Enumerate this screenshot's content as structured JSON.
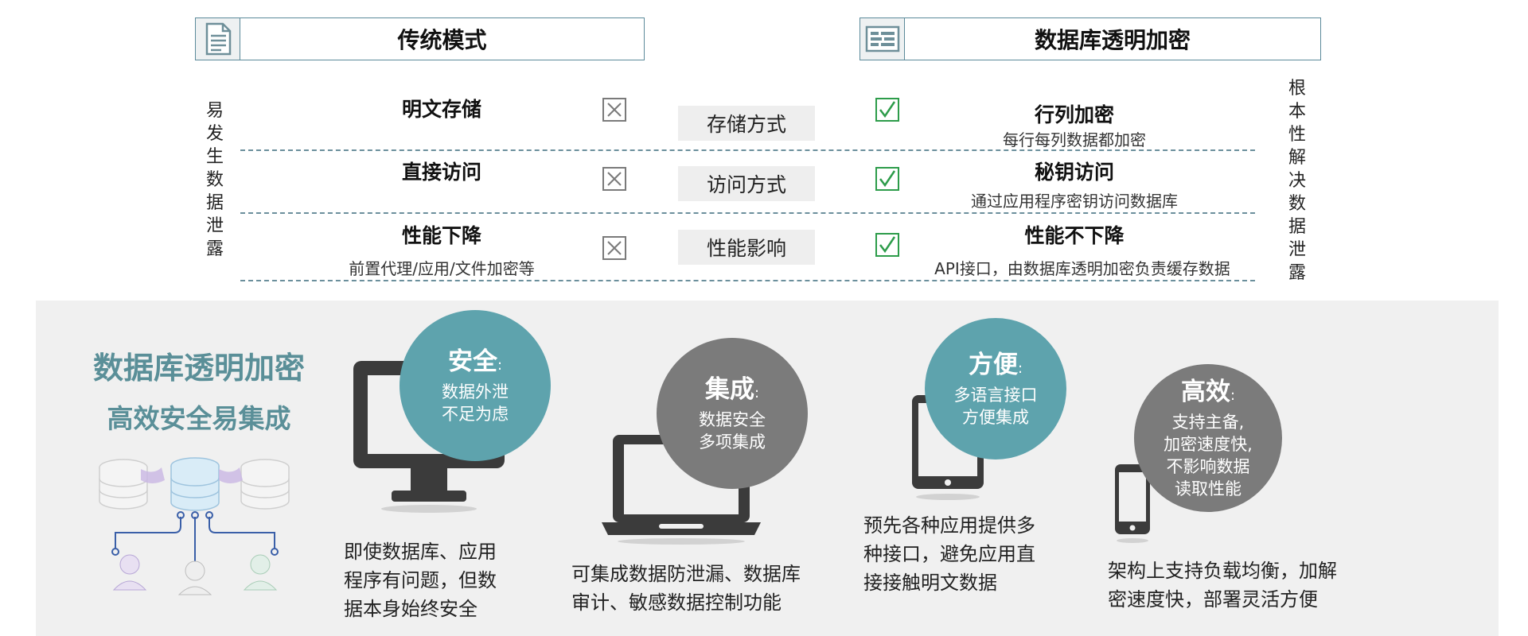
{
  "headers": {
    "left_title": "传统模式",
    "left_icon": "document-icon",
    "right_title": "数据库透明加密",
    "right_icon": "database-panel-icon"
  },
  "side_labels": {
    "left": "易发生数据泄露",
    "right": "根本性解决数据泄露"
  },
  "rows": [
    {
      "left_main": "明文存储",
      "left_sub": "",
      "criterion": "存储方式",
      "right_main": "行列加密",
      "right_sub": "每行每列数据都加密"
    },
    {
      "left_main": "直接访问",
      "left_sub": "",
      "criterion": "访问方式",
      "right_main": "秘钥访问",
      "right_sub": "通过应用程序密钥访问数据库"
    },
    {
      "left_main": "性能下降",
      "left_sub": "前置代理/应用/文件加密等",
      "criterion": "性能影响",
      "right_main": "性能不下降",
      "right_sub": "API接口，由数据库透明加密负责缓存数据"
    }
  ],
  "brand": {
    "line1": "数据库透明加密",
    "line2": "高效安全易集成"
  },
  "features": [
    {
      "title": "安全",
      "colon": ":",
      "lines": [
        "数据外泄",
        "不足为虑"
      ],
      "desc": [
        "即使数据库、应用",
        "程序有问题，但数",
        "据本身始终安全"
      ],
      "device": "desktop-monitor-icon"
    },
    {
      "title": "集成",
      "colon": ":",
      "lines": [
        "数据安全",
        "多项集成"
      ],
      "desc": [
        "可集成数据防泄漏、数据库",
        "审计、敏感数据控制功能"
      ],
      "device": "laptop-icon"
    },
    {
      "title": "方便",
      "colon": ":",
      "lines": [
        "多语言接口",
        "方便集成"
      ],
      "desc": [
        "预先各种应用提供多",
        "种接口，避免应用直",
        "接接触明文数据"
      ],
      "device": "tablet-icon"
    },
    {
      "title": "高效",
      "colon": ":",
      "lines": [
        "支持主备,",
        "加密速度快,",
        "不影响数据",
        "读取性能"
      ],
      "desc": [
        "架构上支持负载均衡，加解",
        "密速度快，部署灵活方便"
      ],
      "device": "smartphone-icon"
    }
  ],
  "colors": {
    "teal": "#5ea3ad",
    "grey": "#7b7b7b",
    "check_green": "#2d9c4a",
    "brand_text": "#5a8f98",
    "panel_bg": "#f0f0f0"
  }
}
